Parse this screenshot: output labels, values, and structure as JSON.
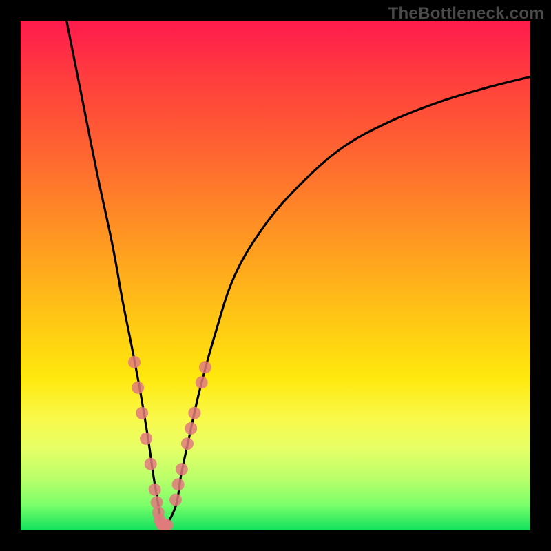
{
  "watermark": "TheBottleneck.com",
  "chart_data": {
    "type": "line",
    "title": "",
    "xlabel": "",
    "ylabel": "",
    "xlim": [
      0,
      100
    ],
    "ylim": [
      0,
      100
    ],
    "grid": false,
    "legend": false,
    "series": [
      {
        "name": "bottleneck-curve",
        "color": "#000000",
        "x": [
          9,
          12,
          15,
          18,
          20,
          22,
          23.5,
          25,
          26,
          27,
          27.5,
          28.5,
          30.5,
          31.5,
          33,
          35,
          38,
          42,
          48,
          55,
          63,
          72,
          82,
          92,
          100
        ],
        "y": [
          100,
          85,
          70,
          56,
          45,
          35,
          27,
          18,
          11,
          5,
          1,
          1,
          5,
          11,
          18,
          27,
          38,
          50,
          60,
          68,
          75,
          80,
          84,
          87,
          89
        ]
      },
      {
        "name": "highlight-dots-left",
        "color": "#e07a7d",
        "type": "scatter",
        "x": [
          22.3,
          23.0,
          23.8,
          24.6,
          25.5,
          26.3,
          26.7,
          27.0,
          27.3,
          27.7,
          28.2,
          28.7
        ],
        "y": [
          33.0,
          28.0,
          23.0,
          18.0,
          13.0,
          8.0,
          5.5,
          3.5,
          2.0,
          1.2,
          1.0,
          1.0
        ]
      },
      {
        "name": "highlight-dots-right",
        "color": "#e07a7d",
        "type": "scatter",
        "x": [
          30.4,
          30.9,
          31.6,
          32.7,
          33.4,
          34.1,
          35.5,
          36.2
        ],
        "y": [
          6.0,
          9.0,
          12.0,
          17.0,
          20.0,
          23.0,
          29.0,
          32.0
        ]
      }
    ],
    "annotations": []
  }
}
